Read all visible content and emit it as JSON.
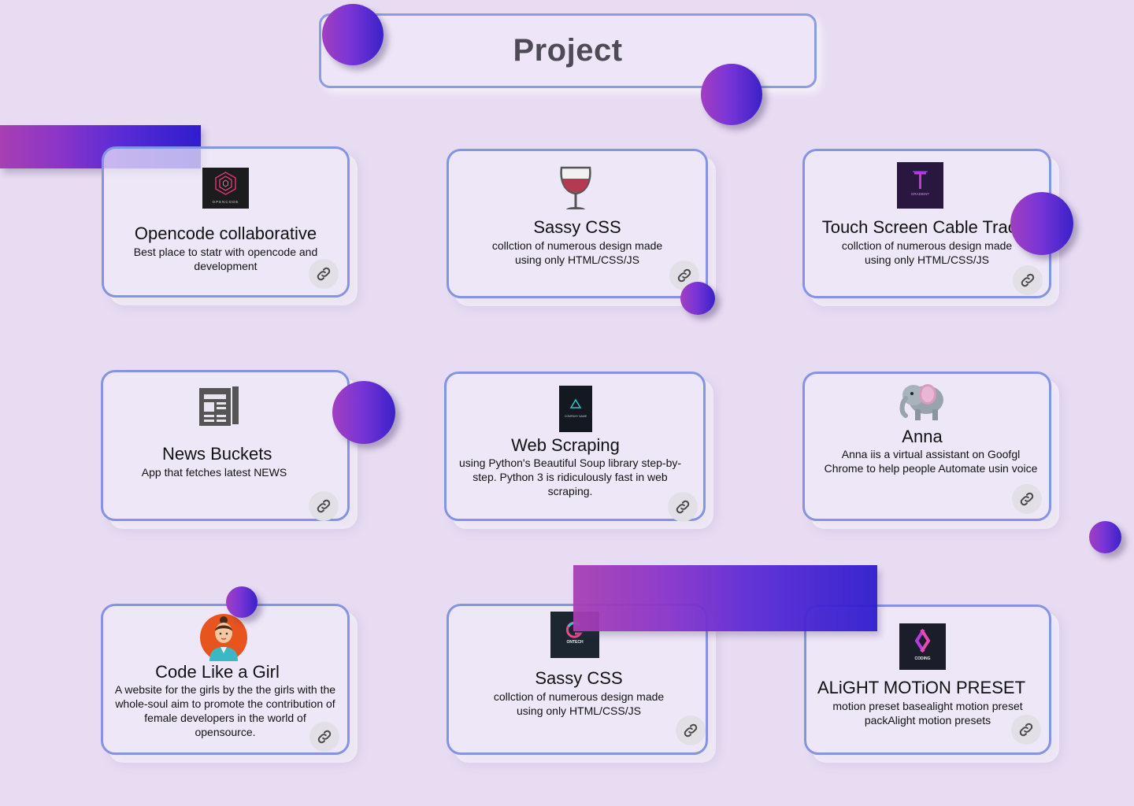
{
  "header": {
    "title": "Project"
  },
  "link_icon": "link-icon",
  "cards": [
    {
      "name": "Opencode collaborative",
      "desc": "Best place to statr with opencode and development",
      "image": "opencode-logo",
      "logo_text": "OPENCODE"
    },
    {
      "name": "Sassy CSS",
      "desc": "collction of numerous design made using only HTML/CSS/JS",
      "image": "wine-glass-icon"
    },
    {
      "name": "Touch Screen Cable Tracer",
      "desc": "collction of numerous design made using only HTML/CSS/JS",
      "image": "gradient-logo",
      "logo_text": "GRADIENT"
    },
    {
      "name": "News Buckets",
      "desc": "App that fetches latest NEWS",
      "image": "newspaper-icon"
    },
    {
      "name": "Web Scraping",
      "desc": "using Python's Beautiful Soup library step-by-step. Python 3 is ridiculously fast in web scraping.",
      "image": "company-logo",
      "logo_text": "COMPANY NAME"
    },
    {
      "name": "Anna",
      "desc": "Anna iis a virtual assistant on Goofgl Chrome to help people Automate usin voice",
      "image": "elephant-icon"
    },
    {
      "name": "Code Like a Girl",
      "desc": "A website for the girls by the the girls with the whole-soul aim to promote the contribution of female developers in the world of opensource.",
      "image": "girl-avatar"
    },
    {
      "name": "Sassy CSS",
      "desc": "collction of numerous design made using only HTML/CSS/JS",
      "image": "ontech-logo",
      "logo_text": "ONTECH"
    },
    {
      "name": "ALiGHT MOTiON PRESET",
      "desc": "motion preset basealight motion preset packAlight motion presets",
      "image": "coding-logo",
      "logo_text": "CODING"
    }
  ],
  "colors": {
    "background": "#e8dcf3",
    "card_border": "#8593e4",
    "gradient_start": "#a83fb3",
    "gradient_end": "#2f1dcd"
  }
}
